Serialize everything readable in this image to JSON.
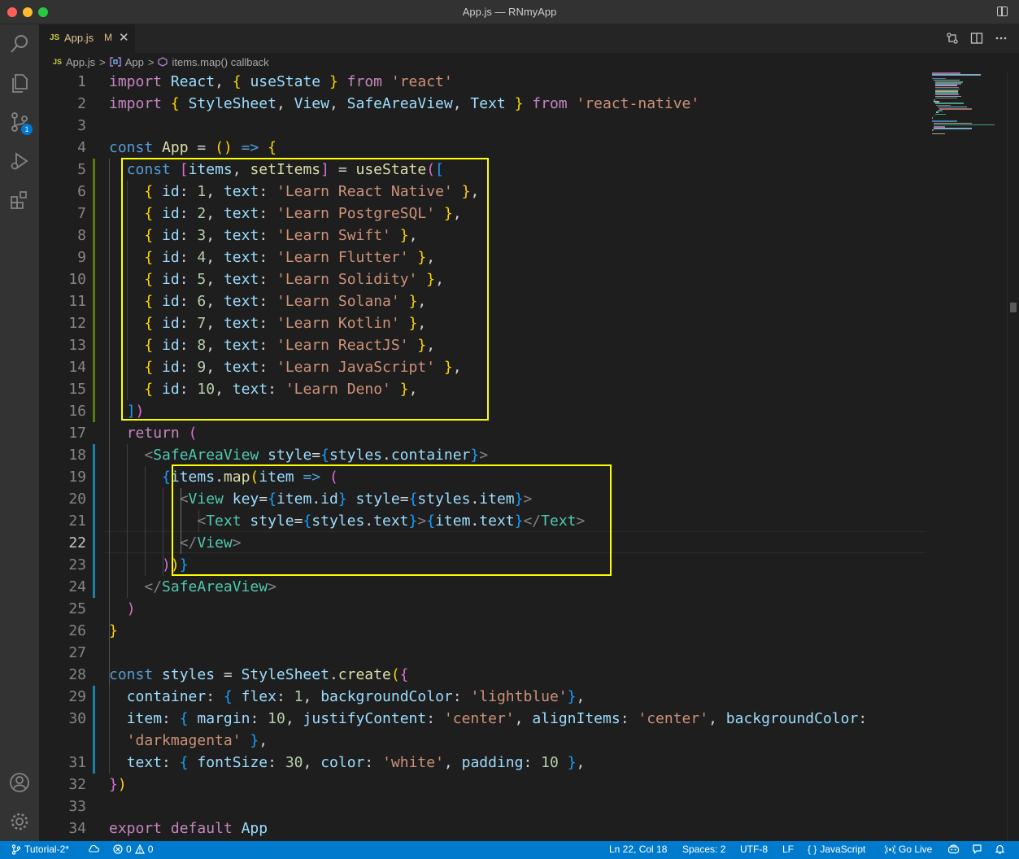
{
  "window": {
    "title": "App.js — RNmyApp"
  },
  "tab": {
    "lang": "JS",
    "name": "App.js",
    "status": "M"
  },
  "breadcrumb": {
    "lang": "JS",
    "file": "App.js",
    "sep": ">",
    "symbol1": "App",
    "symbol2": "items.map() callback"
  },
  "activity": {
    "source_control_badge": "1"
  },
  "statusbar": {
    "branch": "Tutorial-2*",
    "errors": "0",
    "warnings": "0",
    "cursor": "Ln 22, Col 18",
    "spaces": "Spaces: 2",
    "encoding": "UTF-8",
    "eol": "LF",
    "language": "JavaScript",
    "golive": "Go Live"
  },
  "editor": {
    "current_line": 22,
    "lines": [
      {
        "n": "1",
        "html": "<span class='kw2'>import</span> <span class='var'>React</span>, <span class='br'>{</span> <span class='var'>useState</span> <span class='br'>}</span> <span class='kw2'>from</span> <span class='str'>'react'</span>"
      },
      {
        "n": "2",
        "html": "<span class='kw2'>import</span> <span class='br'>{</span> <span class='var'>StyleSheet</span>, <span class='var'>View</span>, <span class='var'>SafeAreaView</span>, <span class='var'>Text</span> <span class='br'>}</span> <span class='kw2'>from</span> <span class='str'>'react-native'</span>"
      },
      {
        "n": "3",
        "html": ""
      },
      {
        "n": "4",
        "html": "<span class='kw'>const</span> <span class='fn'>App</span> = <span class='br'>()</span> <span class='kw'>=&gt;</span> <span class='br'>{</span>"
      },
      {
        "n": "5",
        "html": "  <span class='kw'>const</span> <span class='br2'>[</span><span class='var'>items</span>, <span class='fn'>setItems</span><span class='br2'>]</span> = <span class='fn'>useState</span><span class='br2'>(</span><span class='br3'>[</span>"
      },
      {
        "n": "6",
        "html": "    <span class='br'>{</span> <span class='var'>id</span>: <span class='num'>1</span>, <span class='var'>text</span>: <span class='str'>'Learn React Native'</span> <span class='br'>}</span>,"
      },
      {
        "n": "7",
        "html": "    <span class='br'>{</span> <span class='var'>id</span>: <span class='num'>2</span>, <span class='var'>text</span>: <span class='str'>'Learn PostgreSQL'</span> <span class='br'>}</span>,"
      },
      {
        "n": "8",
        "html": "    <span class='br'>{</span> <span class='var'>id</span>: <span class='num'>3</span>, <span class='var'>text</span>: <span class='str'>'Learn Swift'</span> <span class='br'>}</span>,"
      },
      {
        "n": "9",
        "html": "    <span class='br'>{</span> <span class='var'>id</span>: <span class='num'>4</span>, <span class='var'>text</span>: <span class='str'>'Learn Flutter'</span> <span class='br'>}</span>,"
      },
      {
        "n": "10",
        "html": "    <span class='br'>{</span> <span class='var'>id</span>: <span class='num'>5</span>, <span class='var'>text</span>: <span class='str'>'Learn Solidity'</span> <span class='br'>}</span>,"
      },
      {
        "n": "11",
        "html": "    <span class='br'>{</span> <span class='var'>id</span>: <span class='num'>6</span>, <span class='var'>text</span>: <span class='str'>'Learn Solana'</span> <span class='br'>}</span>,"
      },
      {
        "n": "12",
        "html": "    <span class='br'>{</span> <span class='var'>id</span>: <span class='num'>7</span>, <span class='var'>text</span>: <span class='str'>'Learn Kotlin'</span> <span class='br'>}</span>,"
      },
      {
        "n": "13",
        "html": "    <span class='br'>{</span> <span class='var'>id</span>: <span class='num'>8</span>, <span class='var'>text</span>: <span class='str'>'Learn ReactJS'</span> <span class='br'>}</span>,"
      },
      {
        "n": "14",
        "html": "    <span class='br'>{</span> <span class='var'>id</span>: <span class='num'>9</span>, <span class='var'>text</span>: <span class='str'>'Learn JavaScript'</span> <span class='br'>}</span>,"
      },
      {
        "n": "15",
        "html": "    <span class='br'>{</span> <span class='var'>id</span>: <span class='num'>10</span>, <span class='var'>text</span>: <span class='str'>'Learn Deno'</span> <span class='br'>}</span>,"
      },
      {
        "n": "16",
        "html": "  <span class='br3'>]</span><span class='br2'>)</span>"
      },
      {
        "n": "17",
        "html": "  <span class='kw2'>return</span> <span class='br2'>(</span>"
      },
      {
        "n": "18",
        "html": "    <span class='tagp'>&lt;</span><span class='tag'>SafeAreaView</span> <span class='attr'>style</span>=<span class='br3'>{</span><span class='var'>styles</span>.<span class='var'>container</span><span class='br3'>}</span><span class='tagp'>&gt;</span>"
      },
      {
        "n": "19",
        "html": "      <span class='br3'>{</span><span class='var'>items</span>.<span class='fn'>map</span><span class='br'>(</span><span class='var'>item</span> <span class='kw'>=&gt;</span> <span class='br2'>(</span>"
      },
      {
        "n": "20",
        "html": "        <span class='tagp'>&lt;</span><span class='tag'>View</span> <span class='attr'>key</span>=<span class='br3'>{</span><span class='var'>item</span>.<span class='var'>id</span><span class='br3'>}</span> <span class='attr'>style</span>=<span class='br3'>{</span><span class='var'>styles</span>.<span class='var'>item</span><span class='br3'>}</span><span class='tagp'>&gt;</span>"
      },
      {
        "n": "21",
        "html": "          <span class='tagp'>&lt;</span><span class='tag'>Text</span> <span class='attr'>style</span>=<span class='br3'>{</span><span class='var'>styles</span>.<span class='var'>text</span><span class='br3'>}</span><span class='tagp'>&gt;</span><span class='br3'>{</span><span class='var'>item</span>.<span class='var'>text</span><span class='br3'>}</span><span class='tagp'>&lt;/</span><span class='tag'>Text</span><span class='tagp'>&gt;</span>"
      },
      {
        "n": "22",
        "html": "        <span class='tagp'>&lt;/</span><span class='tag'>View</span><span class='tagp'>&gt;</span>"
      },
      {
        "n": "23",
        "html": "      <span class='br2'>)</span><span class='br'>)</span><span class='br3'>}</span>"
      },
      {
        "n": "24",
        "html": "    <span class='tagp'>&lt;/</span><span class='tag'>SafeAreaView</span><span class='tagp'>&gt;</span>"
      },
      {
        "n": "25",
        "html": "  <span class='br2'>)</span>"
      },
      {
        "n": "26",
        "html": "<span class='br'>}</span>"
      },
      {
        "n": "27",
        "html": ""
      },
      {
        "n": "28",
        "html": "<span class='kw'>const</span> <span class='var'>styles</span> = <span class='var'>StyleSheet</span>.<span class='fn'>create</span><span class='br'>(</span><span class='br2'>{</span>"
      },
      {
        "n": "29",
        "html": "  <span class='var'>container</span>: <span class='br3'>{</span> <span class='var'>flex</span>: <span class='num'>1</span>, <span class='var'>backgroundColor</span>: <span class='str'>'lightblue'</span><span class='br3'>}</span>,"
      },
      {
        "n": "30",
        "html": "  <span class='var'>item</span>: <span class='br3'>{</span> <span class='var'>margin</span>: <span class='num'>10</span>, <span class='var'>justifyContent</span>: <span class='str'>'center'</span>, <span class='var'>alignItems</span>: <span class='str'>'center'</span>, <span class='var'>backgroundColor</span>:"
      },
      {
        "n": "",
        "html": "  <span class='str'>'darkmagenta'</span> <span class='br3'>}</span>,"
      },
      {
        "n": "31",
        "html": "  <span class='var'>text</span>: <span class='br3'>{</span> <span class='var'>fontSize</span>: <span class='num'>30</span>, <span class='var'>color</span>: <span class='str'>'white'</span>, <span class='var'>padding</span>: <span class='num'>10</span> <span class='br3'>}</span>,"
      },
      {
        "n": "32",
        "html": "<span class='br2'>}</span><span class='br'>)</span>"
      },
      {
        "n": "33",
        "html": ""
      },
      {
        "n": "34",
        "html": "<span class='kw2'>export</span> <span class='kw2'>default</span> <span class='var'>App</span>"
      }
    ]
  }
}
